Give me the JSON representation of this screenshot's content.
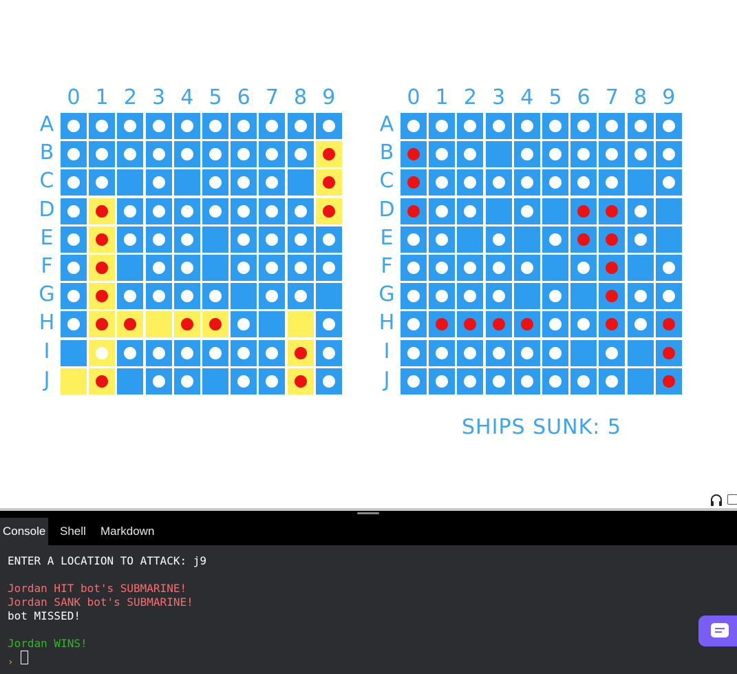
{
  "columns": [
    "0",
    "1",
    "2",
    "3",
    "4",
    "5",
    "6",
    "7",
    "8",
    "9"
  ],
  "rows": [
    "A",
    "B",
    "C",
    "D",
    "E",
    "F",
    "G",
    "H",
    "I",
    "J"
  ],
  "boards": [
    {
      "name": "player-board",
      "grid": [
        "mmmmmmmmmm",
        "mmmmmmmmmH",
        "mm.m.mmm.H",
        "mHmmmmmmmH",
        "mHmmm.mmmm",
        "mH.mm.mmmm",
        "mHmmmm.mm.",
        "mHH.HHm..m",
        ".mmmmmmmHm",
        ".H.mm.mmHm"
      ],
      "ships": [
        [
          1,
          9
        ],
        [
          2,
          9
        ],
        [
          3,
          9
        ],
        [
          3,
          1
        ],
        [
          4,
          1
        ],
        [
          5,
          1
        ],
        [
          6,
          1
        ],
        [
          7,
          1
        ],
        [
          8,
          1
        ],
        [
          9,
          1
        ],
        [
          7,
          2
        ],
        [
          7,
          3
        ],
        [
          7,
          4
        ],
        [
          7,
          5
        ],
        [
          7,
          8
        ],
        [
          8,
          8
        ],
        [
          9,
          8
        ],
        [
          9,
          0
        ]
      ]
    },
    {
      "name": "bot-board",
      "grid": [
        "mmmmmmmmmm",
        "Hmm.mmmmmm",
        "Hmmmmmmm.m",
        "Hmm.m.HHm.",
        "mm.m.mHHm.",
        "mmmmm.mH.m",
        "mmmm.m.Hmm",
        "mHHHHmmHmH",
        "mmmmmm.m.H",
        "mmmmmmmm.H"
      ],
      "ships": []
    }
  ],
  "ships_sunk": "SHIPS SUNK: 5",
  "tabs": [
    "Console",
    "Shell",
    "Markdown"
  ],
  "console_lines": [
    {
      "text": "ENTER A LOCATION TO ATTACK: j9",
      "color": "white"
    },
    {
      "text": "Jordan HIT bot's SUBMARINE!",
      "color": "red"
    },
    {
      "text": "Jordan SANK bot's SUBMARINE!",
      "color": "red"
    },
    {
      "text": "bot MISSED!",
      "color": "white"
    },
    {
      "text": "Jordan WINS!",
      "color": "green"
    }
  ],
  "prompt_symbol": "›",
  "colors": {
    "water": "#2e9df0",
    "ship": "#fef05a",
    "hit": "#ee1111",
    "miss": "#ffffff",
    "label": "#3ea3f0",
    "chat": "#7a5cf7"
  }
}
